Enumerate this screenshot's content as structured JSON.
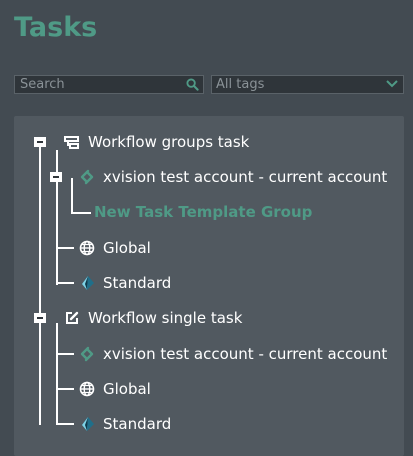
{
  "header": {
    "title": "Tasks"
  },
  "search": {
    "placeholder": "Search"
  },
  "tags_filter": {
    "selected": "All tags"
  },
  "tree": {
    "group_task": {
      "label": "Workflow groups task",
      "account": "xvision test account - current account",
      "template_group": "New Task Template Group",
      "global": "Global",
      "standard": "Standard"
    },
    "single_task": {
      "label": "Workflow single task",
      "account": "xvision test account - current account",
      "global": "Global",
      "standard": "Standard"
    }
  },
  "colors": {
    "accent": "#4f9a86",
    "background": "#434b52",
    "panel": "#515960"
  }
}
